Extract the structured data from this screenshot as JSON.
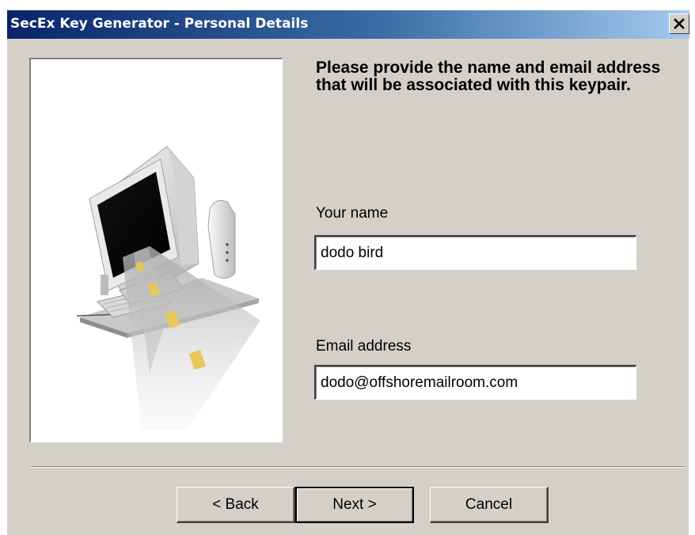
{
  "window": {
    "title": "SecEx Key Generator - Personal Details",
    "close_symbol": "×"
  },
  "icons": {
    "close": "close-icon",
    "illustration": "computer-road-illustration"
  },
  "main": {
    "heading": "Please provide the name and email address that will be associated with this keypair.",
    "name_label": "Your name",
    "name_value": "dodo bird",
    "email_label": "Email address",
    "email_value": "dodo@offshoremailroom.com"
  },
  "buttons": {
    "back": "< Back",
    "next": "Next >",
    "cancel": "Cancel"
  },
  "colors": {
    "title_gradient_start": "#0a246a",
    "title_gradient_end": "#a6caf0",
    "dialog_face": "#d4d0c8"
  }
}
